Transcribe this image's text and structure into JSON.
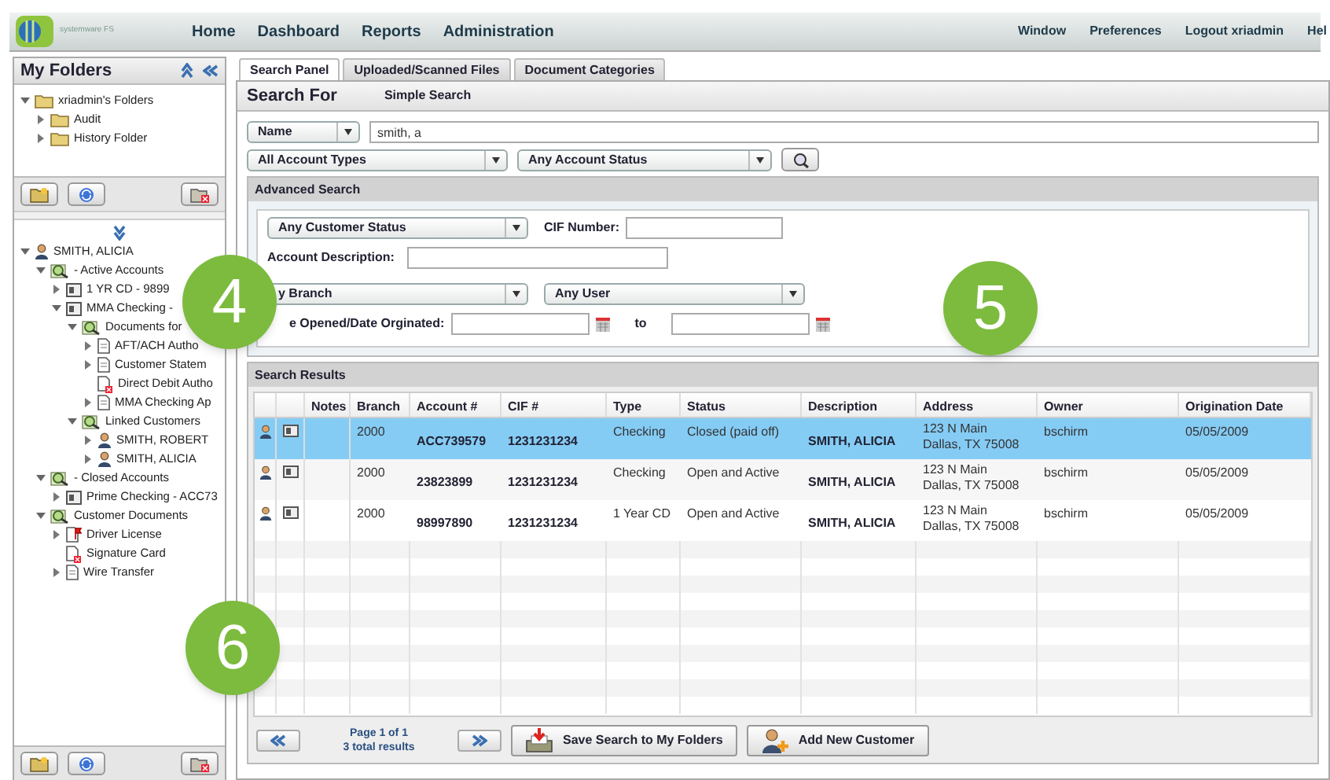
{
  "logo": {
    "text": "systemware FS"
  },
  "nav": [
    "Home",
    "Dashboard",
    "Reports",
    "Administration"
  ],
  "nav_right": [
    "Window",
    "Preferences",
    "Logout xriadmin",
    "Hel"
  ],
  "folders": {
    "title": "My Folders",
    "tree": [
      {
        "label": "xriadmin's Folders",
        "kind": "folder",
        "expanded": true,
        "children": [
          {
            "label": "Audit",
            "kind": "folder",
            "expanded": false
          },
          {
            "label": "History Folder",
            "kind": "folder",
            "expanded": false
          }
        ]
      }
    ]
  },
  "customer_tree": [
    {
      "label": "SMITH, ALICIA",
      "kind": "person",
      "expanded": true,
      "children": [
        {
          "label": "- Active Accounts",
          "kind": "magnifier",
          "expanded": true,
          "children": [
            {
              "label": "1 YR CD - 9899",
              "kind": "card",
              "expanded": false
            },
            {
              "label": "MMA Checking -",
              "kind": "card",
              "expanded": true,
              "children": [
                {
                  "label": "Documents for",
                  "kind": "magnifier",
                  "expanded": true,
                  "children": [
                    {
                      "label": "AFT/ACH Autho",
                      "kind": "doc",
                      "expanded": false
                    },
                    {
                      "label": "Customer Statem",
                      "kind": "doc",
                      "expanded": false
                    },
                    {
                      "label": "Direct Debit Autho",
                      "kind": "doc-error"
                    },
                    {
                      "label": "MMA Checking Ap",
                      "kind": "doc",
                      "expanded": false
                    }
                  ]
                },
                {
                  "label": "Linked Customers",
                  "kind": "magnifier",
                  "expanded": true,
                  "children": [
                    {
                      "label": "SMITH, ROBERT",
                      "kind": "person",
                      "expanded": false
                    },
                    {
                      "label": "SMITH, ALICIA",
                      "kind": "person",
                      "expanded": false
                    }
                  ]
                }
              ]
            }
          ]
        },
        {
          "label": "- Closed Accounts",
          "kind": "magnifier",
          "expanded": true,
          "children": [
            {
              "label": "Prime Checking - ACC73",
              "kind": "card",
              "expanded": false
            }
          ]
        },
        {
          "label": "Customer Documents",
          "kind": "magnifier",
          "expanded": true,
          "children": [
            {
              "label": "Driver License",
              "kind": "doc-flag",
              "expanded": false
            },
            {
              "label": "Signature Card",
              "kind": "doc-error"
            },
            {
              "label": "Wire Transfer",
              "kind": "doc",
              "expanded": false
            }
          ]
        }
      ]
    }
  ],
  "tabs": [
    {
      "label": "Search Panel",
      "selected": true
    },
    {
      "label": "Uploaded/Scanned Files",
      "selected": false
    },
    {
      "label": "Document Categories",
      "selected": false
    }
  ],
  "search": {
    "title": "Search For",
    "mode": "Simple Search",
    "field_select": "Name",
    "query": "smith, a",
    "account_types": "All Account Types",
    "account_status": "Any Account Status"
  },
  "advanced": {
    "title": "Advanced Search",
    "customer_status": "Any Customer Status",
    "cif_label": "CIF Number:",
    "description_label": "Account Description:",
    "branch": "y Branch",
    "user": "Any User",
    "date_label": "e Opened/Date Orginated:",
    "to_label": "to"
  },
  "results": {
    "title": "Search Results",
    "columns": [
      "Notes",
      "Branch",
      "Account #",
      "CIF #",
      "Type",
      "Status",
      "Description",
      "Address",
      "Owner",
      "Origination Date"
    ],
    "rows": [
      {
        "selected": true,
        "branch": "2000",
        "account": "ACC739579",
        "cif": "1231231234",
        "type": "Checking",
        "status": "Closed (paid off)",
        "description": "SMITH, ALICIA",
        "address": [
          "123 N Main",
          "Dallas, TX 75008"
        ],
        "owner": "bschirm",
        "date": "05/05/2009"
      },
      {
        "selected": false,
        "branch": "2000",
        "account": "23823899",
        "cif": "1231231234",
        "type": "Checking",
        "status": "Open and Active",
        "description": "SMITH, ALICIA",
        "address": [
          "123 N Main",
          "Dallas, TX 75008"
        ],
        "owner": "bschirm",
        "date": "05/05/2009"
      },
      {
        "selected": false,
        "branch": "2000",
        "account": "98997890",
        "cif": "1231231234",
        "type": "1 Year CD",
        "status": "Open and Active",
        "description": "SMITH, ALICIA",
        "address": [
          "123 N Main",
          "Dallas, TX 75008"
        ],
        "owner": "bschirm",
        "date": "05/05/2009"
      }
    ]
  },
  "pager": {
    "page": "Page 1 of 1",
    "total": "3 total results"
  },
  "actions": [
    {
      "label": "Save Search to My Folders",
      "kind": "save"
    },
    {
      "label": "Add New Customer",
      "kind": "add-customer"
    }
  ],
  "callouts": [
    "4",
    "5",
    "6"
  ]
}
